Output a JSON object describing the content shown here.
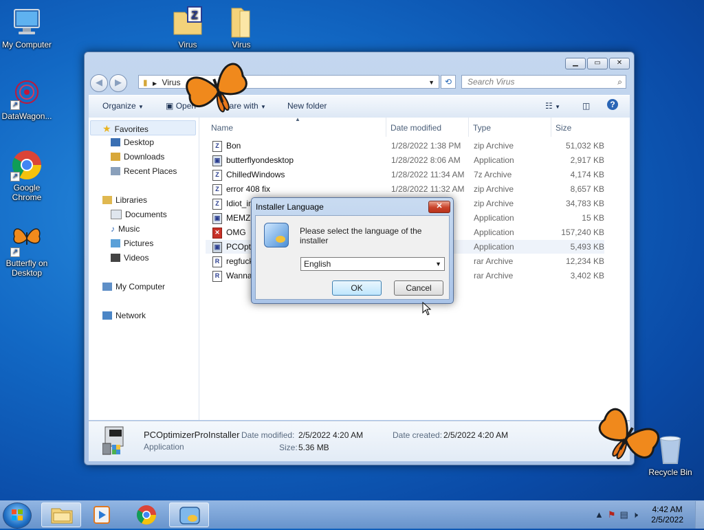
{
  "desktop": {
    "icons": [
      {
        "label": "My Computer"
      },
      {
        "label": "DataWagon..."
      },
      {
        "label": "Google Chrome"
      },
      {
        "label": "Butterfly on Desktop"
      },
      {
        "label": "Virus"
      },
      {
        "label": "Virus"
      },
      {
        "label": "Recycle Bin"
      }
    ]
  },
  "explorer": {
    "address": "Virus",
    "search_placeholder": "Search Virus",
    "toolbar": {
      "organize": "Organize",
      "open": "Open",
      "share_with": "Share with",
      "new_folder": "New folder"
    },
    "nav": {
      "favorites": "Favorites",
      "desktop": "Desktop",
      "downloads": "Downloads",
      "recent": "Recent Places",
      "libraries": "Libraries",
      "documents": "Documents",
      "music": "Music",
      "pictures": "Pictures",
      "videos": "Videos",
      "computer": "My Computer",
      "network": "Network"
    },
    "columns": {
      "name": "Name",
      "date": "Date modified",
      "type": "Type",
      "size": "Size"
    },
    "files": [
      {
        "name": "Bon",
        "date": "1/28/2022 1:38 PM",
        "type": "zip Archive",
        "size": "51,032 KB",
        "icon": "Z"
      },
      {
        "name": "butterflyondesktop",
        "date": "1/28/2022 8:06 AM",
        "type": "Application",
        "size": "2,917 KB",
        "icon": "app"
      },
      {
        "name": "ChilledWindows",
        "date": "1/28/2022 11:34 AM",
        "type": "7z Archive",
        "size": "4,174 KB",
        "icon": "Z"
      },
      {
        "name": "error 408 fix",
        "date": "1/28/2022 11:32 AM",
        "type": "zip Archive",
        "size": "8,657 KB",
        "icon": "Z"
      },
      {
        "name": "Idiot_in",
        "date": "",
        "type": "zip Archive",
        "size": "34,783 KB",
        "icon": "Z"
      },
      {
        "name": "MEMZ",
        "date": "",
        "type": "Application",
        "size": "15 KB",
        "icon": "app"
      },
      {
        "name": "OMG",
        "date": "",
        "type": "Application",
        "size": "157,240 KB",
        "icon": "x"
      },
      {
        "name": "PCOpti",
        "date": "",
        "type": "Application",
        "size": "5,493 KB",
        "icon": "app"
      },
      {
        "name": "regfuck",
        "date": "",
        "type": "rar Archive",
        "size": "12,234 KB",
        "icon": "R"
      },
      {
        "name": "Wanna",
        "date": "",
        "type": "rar Archive",
        "size": "3,402 KB",
        "icon": "R"
      }
    ],
    "details": {
      "name": "PCOptimizerProInstaller",
      "kind": "Application",
      "modified_label": "Date modified:",
      "modified_value": "2/5/2022 4:20 AM",
      "created_label": "Date created:",
      "created_value": "2/5/2022 4:20 AM",
      "size_label": "Size:",
      "size_value": "5.36 MB"
    }
  },
  "dialog": {
    "title": "Installer Language",
    "message": "Please select the language of the installer",
    "selected_language": "English",
    "ok": "OK",
    "cancel": "Cancel"
  },
  "taskbar": {
    "time": "4:42 AM",
    "date": "2/5/2022"
  }
}
